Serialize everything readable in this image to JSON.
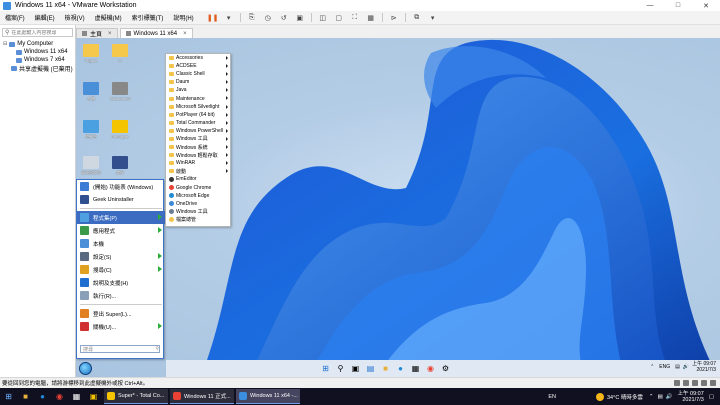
{
  "window": {
    "title": "Windows 11 x64 - VMware Workstation"
  },
  "menus": [
    "檔案(F)",
    "編輯(E)",
    "檢視(V)",
    "虛擬機(M)",
    "索引標籤(T)",
    "說明(H)"
  ],
  "library": {
    "search_placeholder": "在此處鍵入內容搜尋",
    "tree": [
      {
        "label": "My Computer",
        "level": 0
      },
      {
        "label": "Windows 11 x64",
        "level": 1
      },
      {
        "label": "Windows 7 x64",
        "level": 1
      },
      {
        "label": "共享虛擬機 (已棄用)",
        "level": 0
      }
    ]
  },
  "tabs": [
    {
      "label": "主頁"
    },
    {
      "label": "Windows 11 x64"
    }
  ],
  "desktop_icons": [
    {
      "label": "Virgule",
      "color": "#f5c84c"
    },
    {
      "label": "0",
      "color": "#f5c84c"
    },
    {
      "label": "本機",
      "color": "#4a90d9"
    },
    {
      "label": "TotalCmd64",
      "color": "#888888"
    },
    {
      "label": "控制台",
      "color": "#4aa0e0"
    },
    {
      "label": "PotPlayer",
      "color": "#f5c400"
    },
    {
      "label": "資源回收筒",
      "color": "#cfd8e0"
    },
    {
      "label": "儲存",
      "color": "#334e8c"
    }
  ],
  "start_menu": {
    "items": [
      {
        "label": "(開始) 功能表 (Windows)",
        "color": "#3a7bd5",
        "arrow": false,
        "highlight": false
      },
      {
        "label": "Geek Uninstaller",
        "color": "#2f4f8f",
        "arrow": false,
        "highlight": false
      },
      {
        "label": "程式集(P)",
        "color": "#4fa0e0",
        "arrow": true,
        "highlight": true
      },
      {
        "label": "應用程式",
        "color": "#3a9a4a",
        "arrow": true,
        "highlight": false
      },
      {
        "label": "本機",
        "color": "#4a90d9",
        "arrow": false,
        "highlight": false
      },
      {
        "label": "設定(S)",
        "color": "#5a6a80",
        "arrow": true,
        "highlight": false
      },
      {
        "label": "搜尋(C)",
        "color": "#e0a020",
        "arrow": true,
        "highlight": false
      },
      {
        "label": "說明及支援(H)",
        "color": "#1f6fd0",
        "arrow": false,
        "highlight": false
      },
      {
        "label": "執行(R)...",
        "color": "#8aa0b8",
        "arrow": false,
        "highlight": false
      },
      {
        "label": "登出 Super(L)...",
        "color": "#e08020",
        "arrow": false,
        "highlight": false
      },
      {
        "label": "關機(U)...",
        "color": "#d03030",
        "arrow": true,
        "highlight": false
      }
    ],
    "search_placeholder": "搜尋"
  },
  "submenu": {
    "folders": [
      "Accessories",
      "ACDSEE",
      "Classic Shell",
      "Daum",
      "Java",
      "Maintenance",
      "Microsoft Silverlight",
      "PotPlayer (64 bit)",
      "Total Commander",
      "Windows PowerShell",
      "Windows 工具",
      "Windows 系統",
      "Windows 輕鬆存取",
      "WinRAR",
      "啟動"
    ],
    "apps": [
      {
        "label": "EmEditor",
        "color": "#333333"
      },
      {
        "label": "Google Chrome",
        "color": "#e94235"
      },
      {
        "label": "Microsoft Edge",
        "color": "#1e8ad6"
      },
      {
        "label": "OneDrive",
        "color": "#3b88d9"
      },
      {
        "label": "Windows 工具",
        "color": "#6a7c90"
      },
      {
        "label": "檔案總管",
        "color": "#f2c64a"
      }
    ]
  },
  "guest_taskbar": {
    "lang": "ENG",
    "time": "上午 09:07",
    "date": "2021/7/3"
  },
  "status": {
    "text": "要從回到您的電腦，請將游標移到此虛擬機外或按 Ctrl+Alt。"
  },
  "host_taskbar": {
    "tasks": [
      {
        "label": "Super* - Total Co...",
        "color": "#f5c400",
        "active": false
      },
      {
        "label": "Windows 11 正式...",
        "color": "#e94235",
        "active": false
      },
      {
        "label": "Windows 11 x64 -...",
        "color": "#3b8ee0",
        "active": true
      }
    ],
    "lang": "EN",
    "weather": "34°C  晴時多雲",
    "time": "上午 09:07",
    "date": "2021/7/3"
  }
}
